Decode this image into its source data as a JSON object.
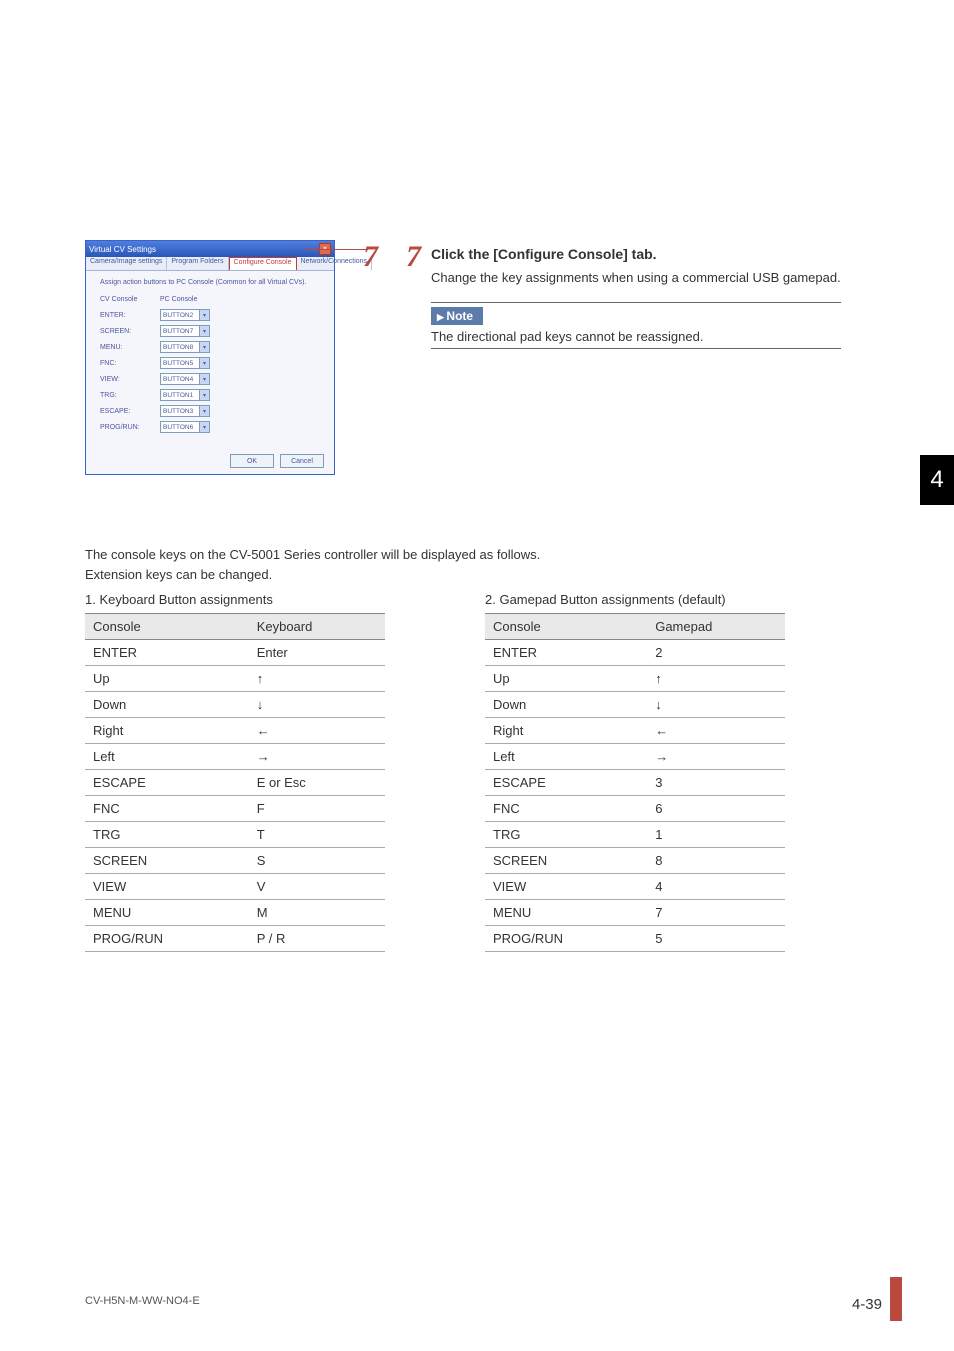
{
  "screenshot": {
    "title": "Virtual CV Settings",
    "tabs": [
      "Camera/Image settings",
      "Program Folders",
      "Configure Console",
      "Network/Connections"
    ],
    "description": "Assign action buttons to PC Console (Common for all Virtual CVs).",
    "headers": [
      "CV Console",
      "PC Console"
    ],
    "rows": [
      {
        "label": "ENTER:",
        "val": "BUTTON2"
      },
      {
        "label": "SCREEN:",
        "val": "BUTTON7"
      },
      {
        "label": "MENU:",
        "val": "BUTTON8"
      },
      {
        "label": "FNC:",
        "val": "BUTTON5"
      },
      {
        "label": "VIEW:",
        "val": "BUTTON4"
      },
      {
        "label": "TRG:",
        "val": "BUTTON1"
      },
      {
        "label": "ESCAPE:",
        "val": "BUTTON3"
      },
      {
        "label": "PROG/RUN:",
        "val": "BUTTON6"
      }
    ],
    "buttons": {
      "ok": "OK",
      "cancel": "Cancel"
    }
  },
  "step": {
    "left_num": "7",
    "right_num": "7",
    "title": "Click the [Configure Console] tab.",
    "desc": "Change the key assignments when using a commercial USB gamepad.",
    "note_label": "Note",
    "note_text": "The directional pad keys cannot be reassigned."
  },
  "chapter_tab": "4",
  "body": {
    "line1": "The console keys on the CV-5001 Series controller will be displayed as follows.",
    "line2": "Extension keys can be changed."
  },
  "table1": {
    "caption": "1. Keyboard Button assignments",
    "h1": "Console",
    "h2": "Keyboard",
    "rows": [
      {
        "a": "ENTER",
        "b": "Enter"
      },
      {
        "a": "Up",
        "b": "↑"
      },
      {
        "a": "Down",
        "b": "↓"
      },
      {
        "a": "Right",
        "b": "←"
      },
      {
        "a": "Left",
        "b": "→"
      },
      {
        "a": "ESCAPE",
        "b": "E or Esc"
      },
      {
        "a": "FNC",
        "b": "F"
      },
      {
        "a": "TRG",
        "b": "T"
      },
      {
        "a": "SCREEN",
        "b": "S"
      },
      {
        "a": "VIEW",
        "b": "V"
      },
      {
        "a": "MENU",
        "b": "M"
      },
      {
        "a": "PROG/RUN",
        "b": "P / R"
      }
    ]
  },
  "table2": {
    "caption": "2. Gamepad Button assignments (default)",
    "h1": "Console",
    "h2": "Gamepad",
    "rows": [
      {
        "a": "ENTER",
        "b": "2"
      },
      {
        "a": "Up",
        "b": "↑"
      },
      {
        "a": "Down",
        "b": "↓"
      },
      {
        "a": "Right",
        "b": "←"
      },
      {
        "a": "Left",
        "b": "→"
      },
      {
        "a": "ESCAPE",
        "b": "3"
      },
      {
        "a": "FNC",
        "b": "6"
      },
      {
        "a": "TRG",
        "b": "1"
      },
      {
        "a": "SCREEN",
        "b": "8"
      },
      {
        "a": "VIEW",
        "b": "4"
      },
      {
        "a": "MENU",
        "b": "7"
      },
      {
        "a": "PROG/RUN",
        "b": "5"
      }
    ]
  },
  "footer": {
    "left": "CV-H5N-M-WW-NO4-E",
    "right": "4-39"
  }
}
